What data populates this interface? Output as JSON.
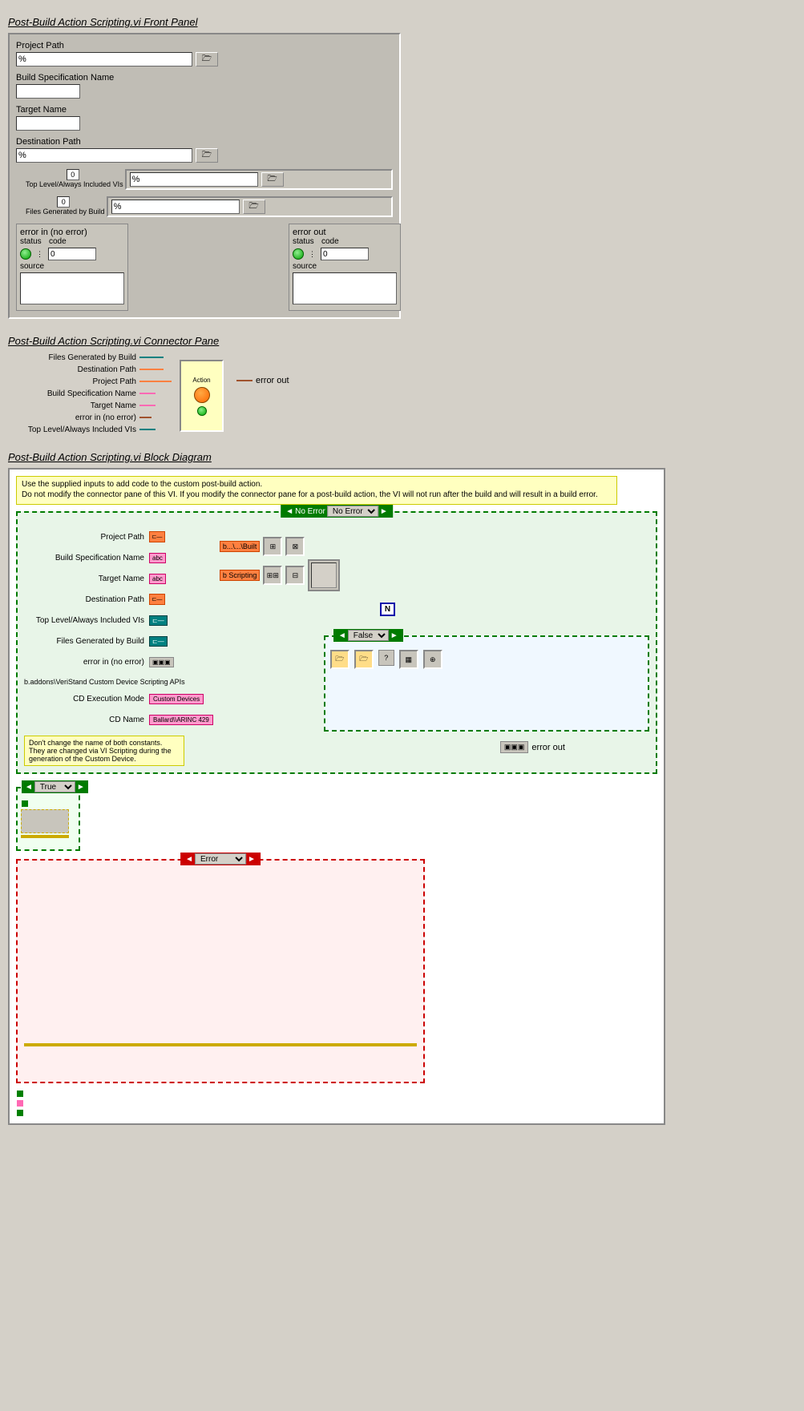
{
  "sections": {
    "front_panel_title": "Post-Build Action Scripting.vi Front Panel",
    "connector_pane_title": "Post-Build Action Scripting.vi Connector Pane",
    "block_diagram_title": "Post-Build Action Scripting.vi Block Diagram"
  },
  "front_panel": {
    "project_path_label": "Project Path",
    "project_path_value": "%",
    "build_spec_name_label": "Build Specification Name",
    "target_name_label": "Target Name",
    "destination_path_label": "Destination Path",
    "destination_path_value": "%",
    "top_level_label": "Top Level/Always Included VIs",
    "files_generated_label": "Files Generated by Build",
    "array_index_0": "0",
    "top_level_vi_value": "%",
    "files_generated_value": "%",
    "error_in_label": "error in (no error)",
    "error_out_label": "error out",
    "status_label": "status",
    "code_label": "code",
    "source_label": "source",
    "error_code_value": "0",
    "folder_btn": "⊏"
  },
  "connector_pane": {
    "terminals": [
      "Files Generated by Build",
      "Destination Path",
      "Project Path",
      "Build Specification Name",
      "Target Name",
      "error in (no error)",
      "Top Level/Always Included VIs"
    ],
    "action_label": "Action",
    "error_out_label": "error out"
  },
  "block_diagram": {
    "note1": "Use the supplied inputs to add code to the custom post-build action.",
    "note2": "Do not modify the connector pane of this VI.  If you modify the connector pane for a post-build action, the VI will not run after the build and will result in a build error.",
    "no_error_frame_label": "No Error",
    "inputs": [
      {
        "label": "Project Path",
        "type": "path"
      },
      {
        "label": "Build Specification Name",
        "type": "pink"
      },
      {
        "label": "Target Name",
        "type": "pink"
      },
      {
        "label": "Destination Path",
        "type": "path"
      },
      {
        "label": "Top Level/Always Included VIs",
        "type": "green"
      },
      {
        "label": "Files Generated by Build",
        "type": "green"
      },
      {
        "label": "error in (no error)",
        "type": "error"
      }
    ],
    "string_const1": "b...\\...\\Built",
    "string_const2": "b Scripting",
    "addons_label": "b.addons\\VeriStand Custom Device Scripting APIs",
    "cd_exec_mode_label": "CD Execution Mode",
    "cd_exec_mode_value": "Custom Devices",
    "cd_name_label": "CD Name",
    "cd_name_value": "Ballard\\\\ARINC 429",
    "comment": "Don't change the name of both constants.\nThey are changed via VI Scripting during\nthe generation of the Custom Device.",
    "error_out_label": "error out",
    "false_frame_label": "False",
    "true_frame_label": "True",
    "error_frame_label": "Error",
    "n_label": "N"
  }
}
